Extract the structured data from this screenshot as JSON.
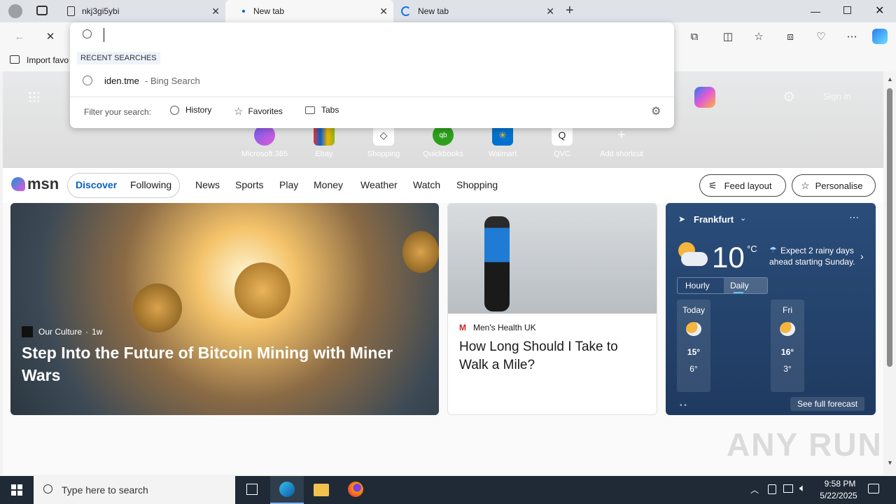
{
  "browser": {
    "tabs": [
      {
        "title": "nkj3gi5ybi",
        "active": false
      },
      {
        "title": "New tab",
        "active": true
      },
      {
        "title": "New tab",
        "active": false
      }
    ],
    "favorites_bar": {
      "import_label": "Import favo"
    }
  },
  "omnibox": {
    "recent_header": "RECENT SEARCHES",
    "recent_items": [
      {
        "query": "iden.tme",
        "source": "- Bing Search"
      }
    ],
    "filter_label": "Filter your search:",
    "filters": [
      "History",
      "Favorites",
      "Tabs"
    ]
  },
  "newtab": {
    "signin_label": "Sign in",
    "shortcuts": [
      "Microsoft 365",
      "Ebay",
      "Shopping",
      "Quickbooks",
      "Walmart",
      "QVC",
      "Add shortcut"
    ]
  },
  "msn": {
    "logo": "msn",
    "tabs": [
      "Discover",
      "Following"
    ],
    "nav": [
      "News",
      "Sports",
      "Play",
      "Money",
      "Weather",
      "Watch",
      "Shopping"
    ],
    "feed_layout": "Feed layout",
    "personalise": "Personalise"
  },
  "cards": {
    "hero": {
      "source": "Our Culture",
      "age": "1w",
      "title": "Step Into the Future of Bitcoin Mining with Miner Wars"
    },
    "side": {
      "source": "Men's Health UK",
      "title": "How Long Should I Take to Walk a Mile?"
    }
  },
  "weather": {
    "city": "Frankfurt",
    "temp": "10",
    "unit": "°C",
    "message": "Expect 2 rainy days ahead starting Sunday.",
    "toggle": [
      "Hourly",
      "Daily"
    ],
    "days": [
      {
        "day": "Today",
        "high": "15°",
        "low": "6°"
      },
      {
        "day": "Fri",
        "high": "16°",
        "low": "3°"
      }
    ],
    "see_full": "See full forecast"
  },
  "watermark": "ANY RUN",
  "taskbar": {
    "search_placeholder": "Type here to search",
    "time": "9:58 PM",
    "date": "5/22/2025"
  }
}
